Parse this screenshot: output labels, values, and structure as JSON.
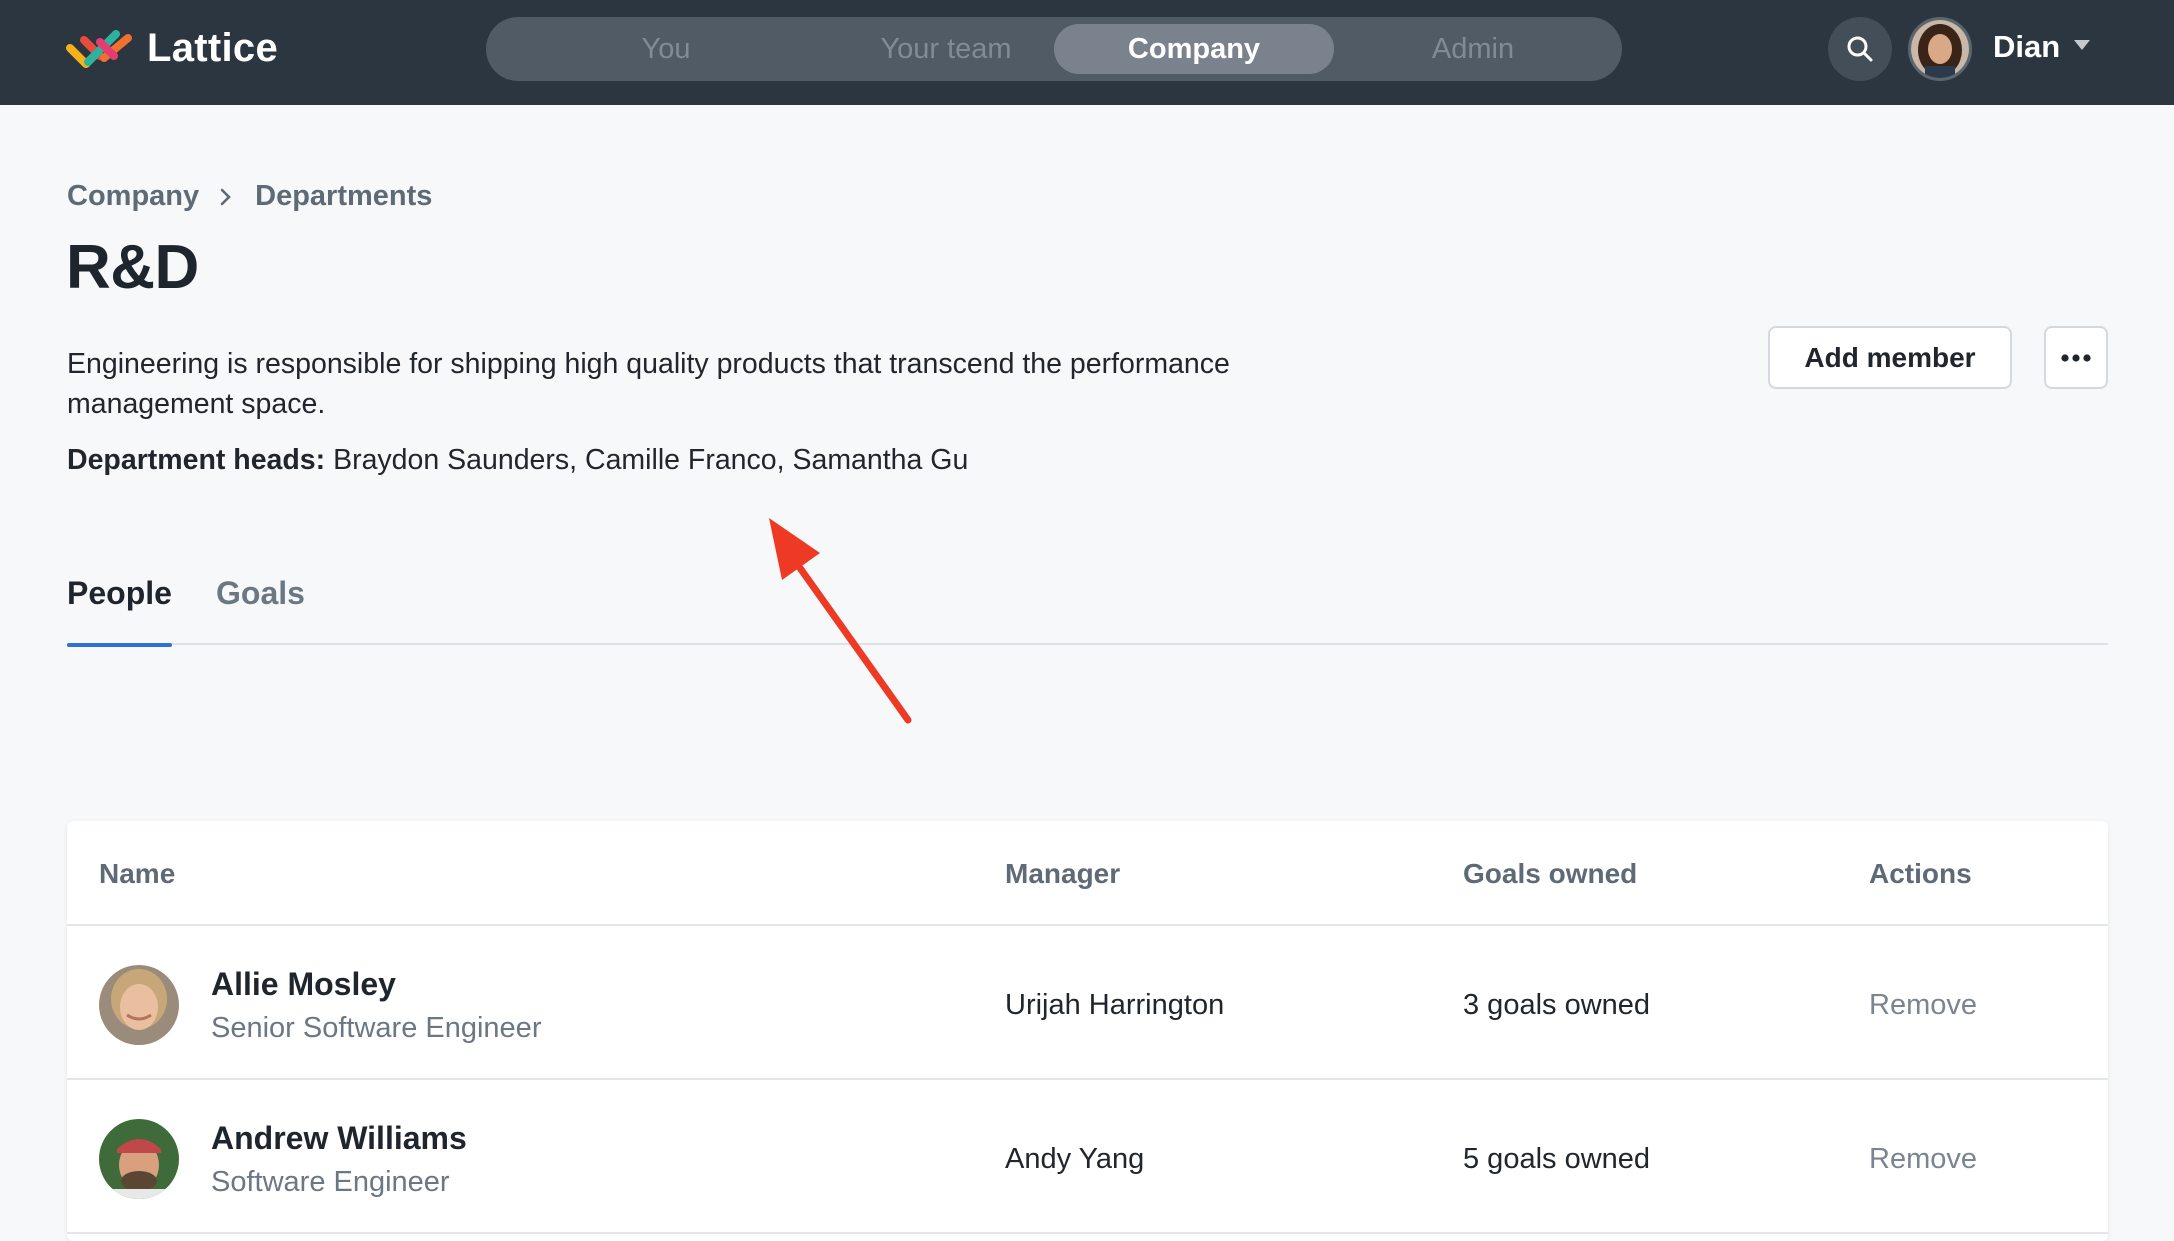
{
  "nav": {
    "logo_text": "Lattice",
    "tabs": [
      {
        "label": "You"
      },
      {
        "label": "Your team"
      },
      {
        "label": "Company"
      },
      {
        "label": "Admin"
      }
    ],
    "active_tab": "Company",
    "user_name": "Dian"
  },
  "breadcrumb": [
    "Company",
    "Departments"
  ],
  "page": {
    "title": "R&D",
    "description": "Engineering is responsible for shipping high quality products that transcend the performance management space.",
    "heads_label": "Department heads:",
    "heads_value": " Braydon Saunders, Camille Franco, Samantha Gu"
  },
  "actions": {
    "add_member_label": "Add member",
    "more_icon": "ellipsis-icon"
  },
  "tabs": [
    {
      "label": "People",
      "active": true
    },
    {
      "label": "Goals",
      "active": false
    }
  ],
  "table": {
    "columns": [
      "Name",
      "Manager",
      "Goals owned",
      "Actions"
    ],
    "rows": [
      {
        "name": "Allie Mosley",
        "title": "Senior Software Engineer",
        "manager": "Urijah Harrington",
        "goals": "3 goals owned",
        "action": "Remove"
      },
      {
        "name": "Andrew Williams",
        "title": "Software Engineer",
        "manager": "Andy Yang",
        "goals": "5 goals owned",
        "action": "Remove"
      }
    ]
  },
  "colors": {
    "topbar": "#2c3641",
    "accent": "#2f6fd6",
    "annotation": "#ee3a24"
  }
}
